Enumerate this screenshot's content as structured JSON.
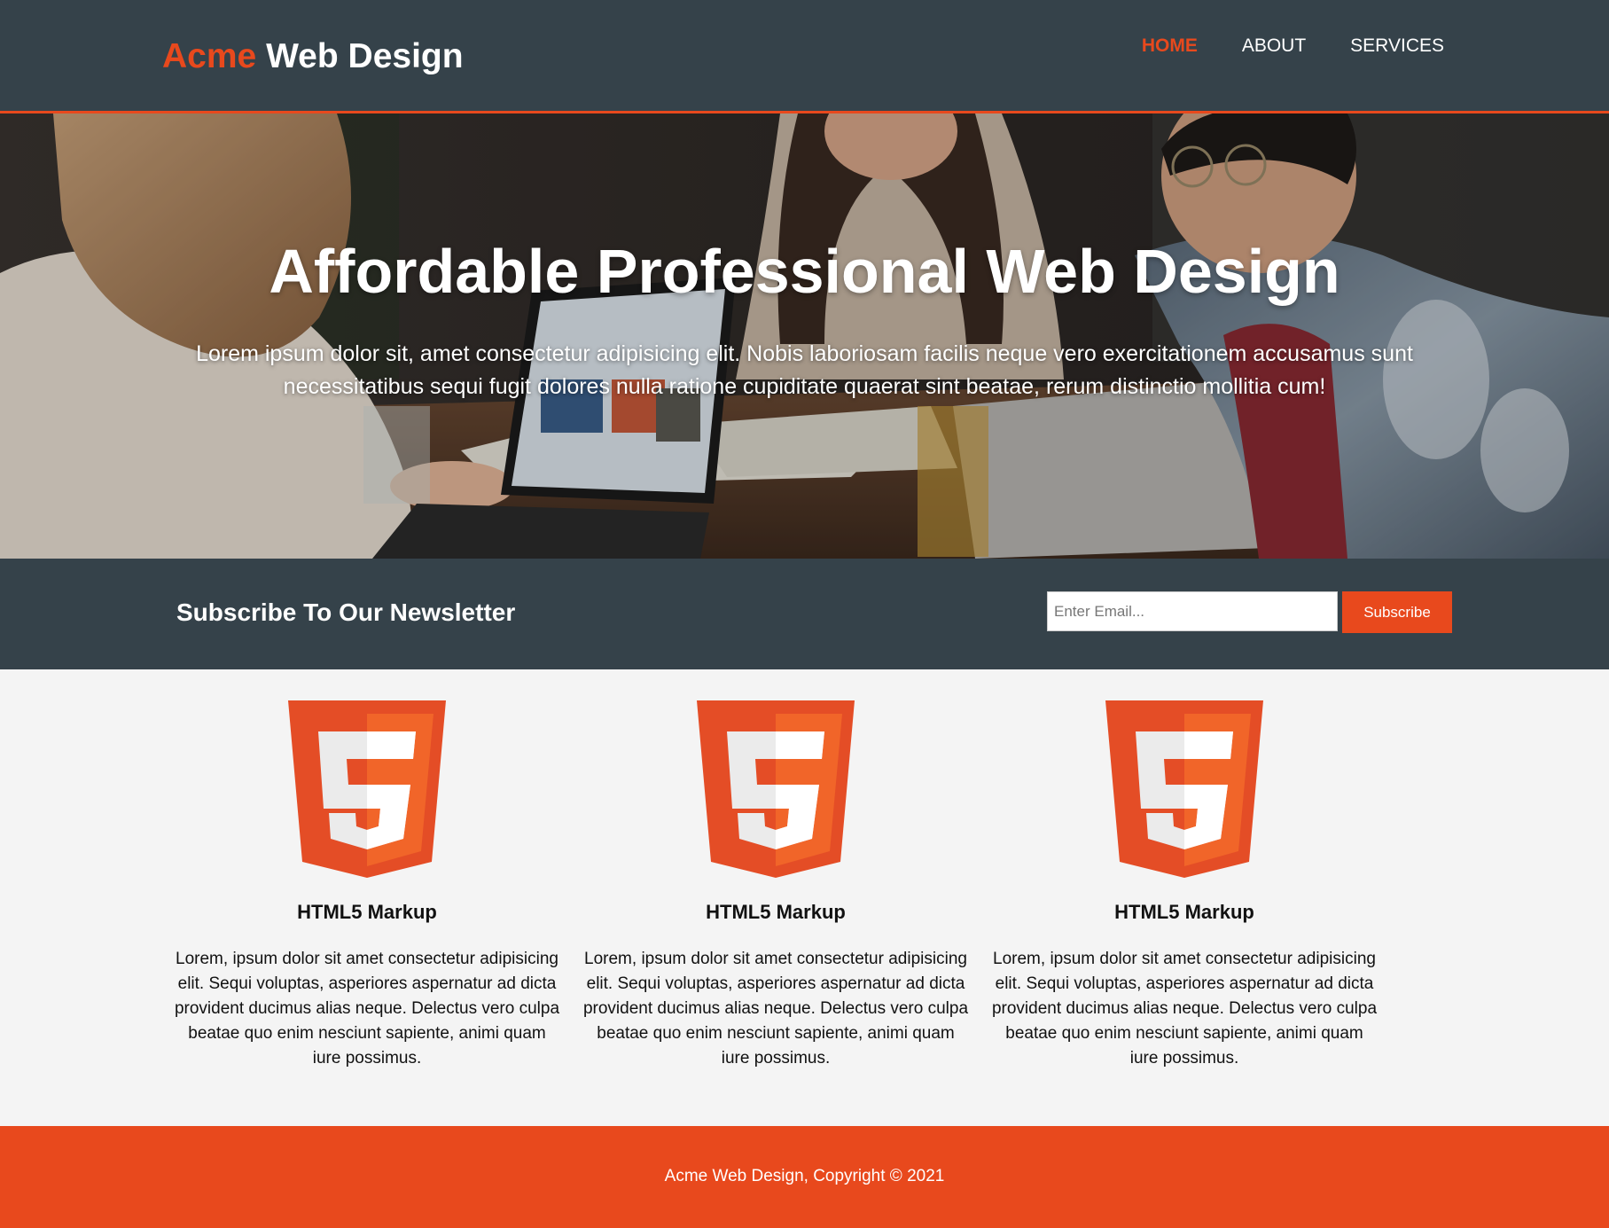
{
  "branding": {
    "highlight": "Acme",
    "rest": " Web Design"
  },
  "nav": {
    "items": [
      {
        "label": "HOME",
        "current": true
      },
      {
        "label": "ABOUT",
        "current": false
      },
      {
        "label": "SERVICES",
        "current": false
      }
    ]
  },
  "showcase": {
    "title": "Affordable Professional Web Design",
    "text": "Lorem ipsum dolor sit, amet consectetur adipisicing elit. Nobis laboriosam facilis neque vero exercitationem accusamus sunt necessitatibus sequi fugit dolores nulla ratione cupiditate quaerat sint beatae, rerum distinctio mollitia cum!"
  },
  "newsletter": {
    "title": "Subscribe To Our Newsletter",
    "email_placeholder": "Enter Email...",
    "email_value": "",
    "button_label": "Subscribe"
  },
  "boxes": [
    {
      "icon": "html5-logo-icon",
      "title": "HTML5 Markup",
      "text": "Lorem, ipsum dolor sit amet consectetur adipisicing elit. Sequi voluptas, asperiores aspernatur ad dicta provident ducimus alias neque. Delectus vero culpa beatae quo enim nesciunt sapiente, animi quam iure possimus."
    },
    {
      "icon": "html5-logo-icon",
      "title": "HTML5 Markup",
      "text": "Lorem, ipsum dolor sit amet consectetur adipisicing elit. Sequi voluptas, asperiores aspernatur ad dicta provident ducimus alias neque. Delectus vero culpa beatae quo enim nesciunt sapiente, animi quam iure possimus."
    },
    {
      "icon": "html5-logo-icon",
      "title": "HTML5 Markup",
      "text": "Lorem, ipsum dolor sit amet consectetur adipisicing elit. Sequi voluptas, asperiores aspernatur ad dicta provident ducimus alias neque. Delectus vero culpa beatae quo enim nesciunt sapiente, animi quam iure possimus."
    }
  ],
  "footer": {
    "text": "Acme Web Design, Copyright © 2021"
  },
  "colors": {
    "header_bg": "#35424a",
    "accent": "#e8491d",
    "body_bg": "#f4f4f4",
    "text_light": "#ffffff"
  }
}
